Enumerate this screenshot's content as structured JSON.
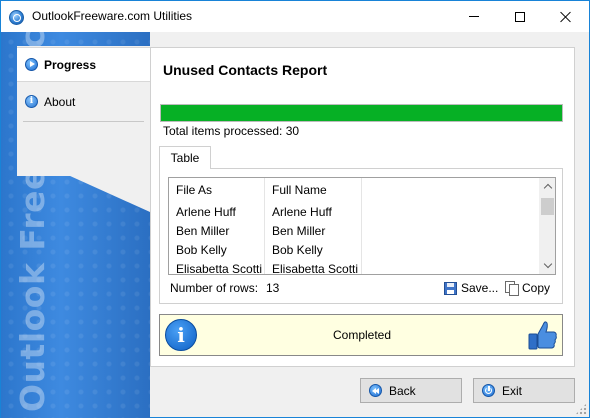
{
  "window": {
    "title": "OutlookFreeware.com Utilities"
  },
  "sidebar": {
    "items": [
      {
        "label": "Progress",
        "icon": "play-icon",
        "active": true
      },
      {
        "label": "About",
        "icon": "info-icon",
        "active": false
      }
    ],
    "watermark": "Outlook Freeware .com"
  },
  "main": {
    "title": "Unused Contacts Report",
    "progress": {
      "percent": 100,
      "color": "#06b025"
    },
    "total_label": "Total items processed: 30",
    "tabs": [
      {
        "label": "Table"
      }
    ],
    "table": {
      "columns": [
        "File As",
        "Full Name"
      ],
      "rows": [
        [
          "Arlene Huff",
          "Arlene Huff"
        ],
        [
          "Ben Miller",
          "Ben Miller"
        ],
        [
          "Bob Kelly",
          "Bob Kelly"
        ],
        [
          "Elisabetta Scotti",
          "Elisabetta Scotti"
        ]
      ]
    },
    "rows_label": "Number of rows:",
    "rows_count": "13",
    "save_label": "Save...",
    "copy_label": "Copy",
    "status": {
      "text": "Completed",
      "background": "#ffffe1"
    }
  },
  "buttons": {
    "back_label": "Back",
    "exit_label": "Exit"
  }
}
